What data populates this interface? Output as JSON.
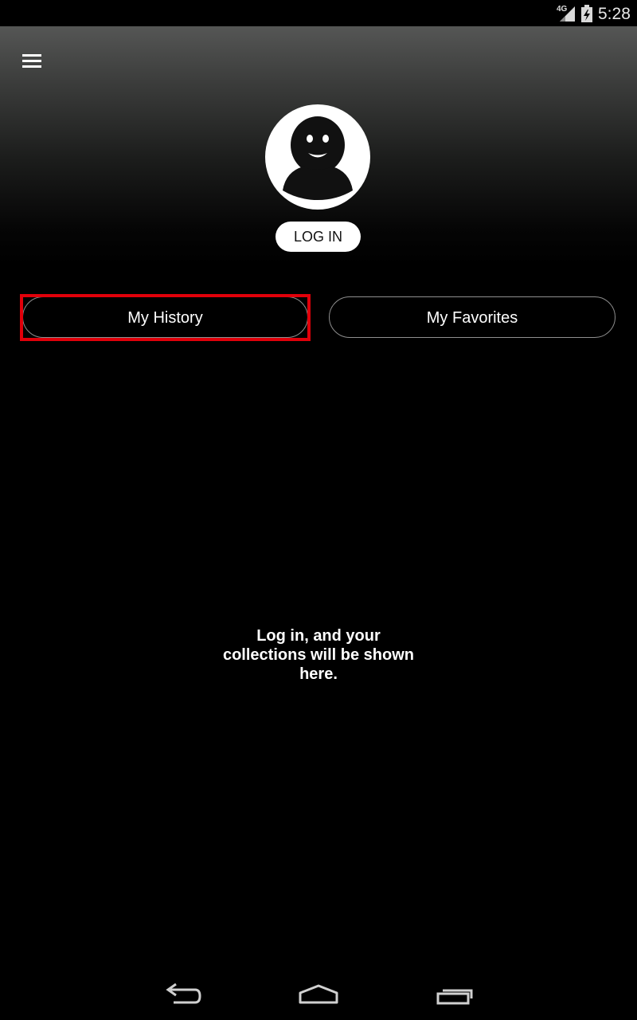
{
  "status_bar": {
    "network": "4G",
    "time": "5:28"
  },
  "header": {
    "login_label": "LOG IN"
  },
  "tabs": [
    {
      "label": "My History",
      "selected": true
    },
    {
      "label": "My Favorites",
      "selected": false
    }
  ],
  "empty_state": {
    "line1": "Log in, and your",
    "line2": "collections will be shown",
    "line3": "here."
  },
  "colors": {
    "background": "#000000",
    "highlight": "#e0000a",
    "tab_border": "#8f8f8f"
  }
}
